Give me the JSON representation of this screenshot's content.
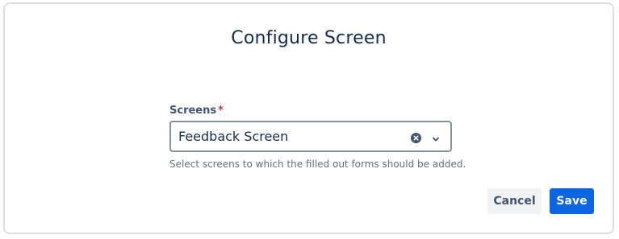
{
  "dialog": {
    "title": "Configure Screen"
  },
  "field": {
    "label": "Screens",
    "required_marker": "*",
    "selected_value": "Feedback Screen",
    "helper_text": "Select screens to which the filled out forms should be added.",
    "clear_icon": "clear-icon",
    "dropdown_icon": "chevron-down-icon"
  },
  "actions": {
    "cancel_label": "Cancel",
    "save_label": "Save"
  },
  "colors": {
    "primary": "#0c66e4",
    "title": "#172b4d",
    "required": "#c9372c"
  }
}
